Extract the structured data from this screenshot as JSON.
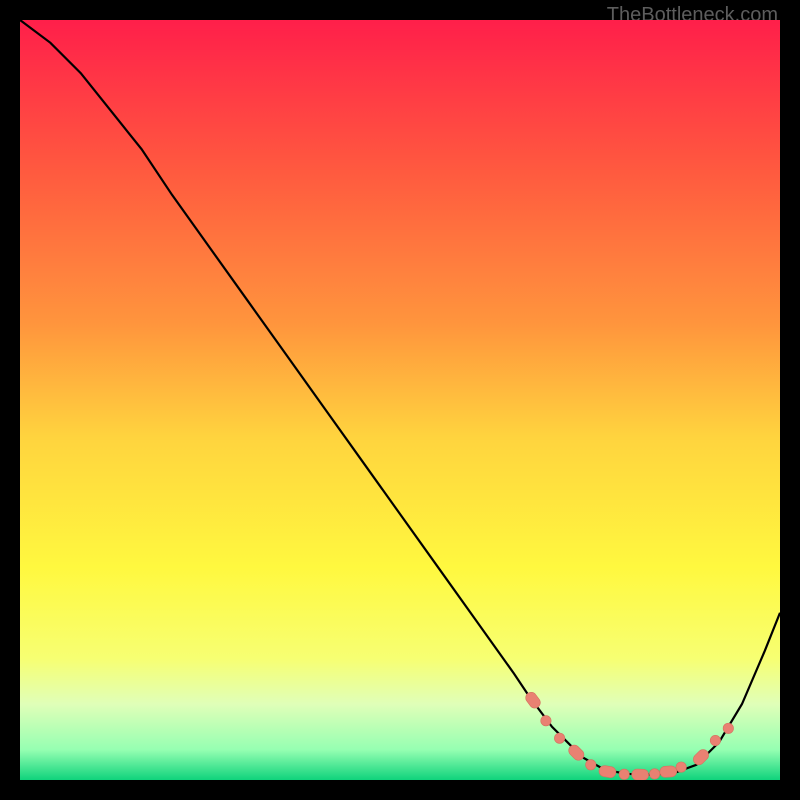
{
  "attribution": "TheBottleneck.com",
  "chart_data": {
    "type": "line",
    "title": "",
    "xlabel": "",
    "ylabel": "",
    "xlim": [
      0,
      100
    ],
    "ylim": [
      0,
      100
    ],
    "background_gradient": {
      "type": "vertical",
      "stops": [
        {
          "pct": 0,
          "color": "#ff1f4a"
        },
        {
          "pct": 20,
          "color": "#ff5a3f"
        },
        {
          "pct": 40,
          "color": "#ff953d"
        },
        {
          "pct": 55,
          "color": "#ffd43e"
        },
        {
          "pct": 72,
          "color": "#fff83f"
        },
        {
          "pct": 84,
          "color": "#f7ff72"
        },
        {
          "pct": 90,
          "color": "#e0ffb8"
        },
        {
          "pct": 96,
          "color": "#96ffb2"
        },
        {
          "pct": 100,
          "color": "#0fd37c"
        }
      ]
    },
    "series": [
      {
        "name": "bottleneck-curve",
        "color": "#000000",
        "x": [
          0,
          4,
          8,
          12,
          16,
          20,
          25,
          30,
          35,
          40,
          45,
          50,
          55,
          60,
          65,
          67,
          70,
          74,
          77,
          80,
          83,
          86,
          89,
          92,
          95,
          98,
          100
        ],
        "y": [
          100,
          97,
          93,
          88,
          83,
          77,
          70,
          63,
          56,
          49,
          42,
          35,
          28,
          21,
          14,
          11,
          7,
          3,
          1.3,
          0.8,
          0.7,
          0.9,
          2,
          5,
          10,
          17,
          22
        ]
      }
    ],
    "markers": {
      "name": "highlight-dots",
      "color": "#e98172",
      "stroke": "#d5735f",
      "points": [
        {
          "x": 67.5,
          "y": 10.5,
          "rtype": "cap"
        },
        {
          "x": 69.2,
          "y": 7.8,
          "rtype": "dot"
        },
        {
          "x": 71.0,
          "y": 5.5,
          "rtype": "dot"
        },
        {
          "x": 73.2,
          "y": 3.6,
          "rtype": "cap"
        },
        {
          "x": 75.1,
          "y": 2.0,
          "rtype": "dot"
        },
        {
          "x": 77.3,
          "y": 1.1,
          "rtype": "cap"
        },
        {
          "x": 79.5,
          "y": 0.75,
          "rtype": "dot"
        },
        {
          "x": 81.6,
          "y": 0.7,
          "rtype": "cap"
        },
        {
          "x": 83.5,
          "y": 0.8,
          "rtype": "dot"
        },
        {
          "x": 85.3,
          "y": 1.1,
          "rtype": "cap"
        },
        {
          "x": 87.0,
          "y": 1.7,
          "rtype": "dot"
        },
        {
          "x": 89.6,
          "y": 3.0,
          "rtype": "cap"
        },
        {
          "x": 91.5,
          "y": 5.2,
          "rtype": "dot"
        },
        {
          "x": 93.2,
          "y": 6.8,
          "rtype": "dot"
        }
      ]
    }
  }
}
